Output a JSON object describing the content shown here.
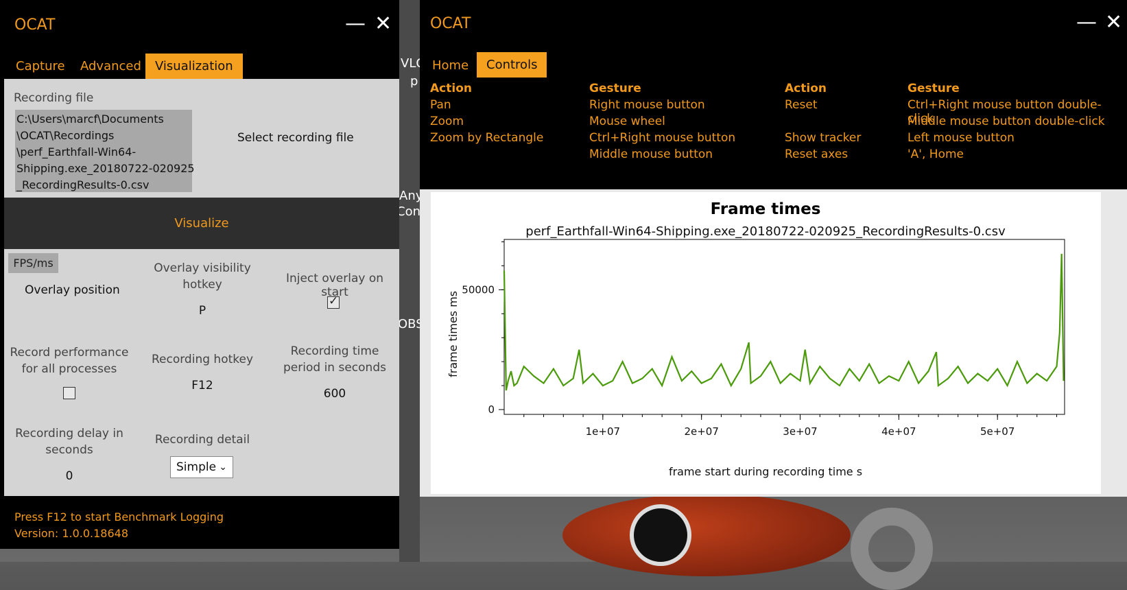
{
  "desktop": {
    "labels": [
      "VLC",
      "p",
      "Any",
      "Conv",
      "OBS"
    ]
  },
  "left_window": {
    "title": "OCAT",
    "tabs": [
      "Capture",
      "Advanced",
      "Visualization"
    ],
    "recording_file_label": "Recording file",
    "recording_file_lines": [
      "C:\\Users\\marcf\\Documents",
      "\\OCAT\\Recordings",
      "\\perf_Earthfall-Win64-",
      "Shipping.exe_20180722-020925",
      "_RecordingResults-0.csv"
    ],
    "select_file_button": "Select recording file",
    "visualize_button": "Visualize",
    "fps_badge": "FPS/ms",
    "overlay_position": "Overlay position",
    "overlay_hotkey_label_1": "Overlay visibility",
    "overlay_hotkey_label_2": "hotkey",
    "overlay_hotkey_value": "P",
    "inject_overlay_label": "Inject overlay on start",
    "record_all_label_1": "Record performance",
    "record_all_label_2": "for all processes",
    "recording_hotkey_label": "Recording hotkey",
    "recording_hotkey_value": "F12",
    "time_period_label_1": "Recording time",
    "time_period_label_2": "period in seconds",
    "time_period_value": "600",
    "delay_label_1": "Recording delay in",
    "delay_label_2": "seconds",
    "delay_value": "0",
    "detail_label": "Recording detail",
    "detail_value": "Simple",
    "footer_line1": "Press F12 to start Benchmark Logging",
    "footer_line2": "Version: 1.0.0.18648"
  },
  "right_window": {
    "title": "OCAT",
    "tabs": [
      "Home",
      "Controls"
    ],
    "controls": {
      "col1_header": "Action",
      "col2_header": "Gesture",
      "col3_header": "Action",
      "col4_header": "Gesture",
      "col1": [
        "Pan",
        "Zoom",
        "Zoom by Rectangle",
        ""
      ],
      "col2": [
        "Right mouse button",
        "Mouse wheel",
        "Ctrl+Right mouse button",
        "Middle mouse button"
      ],
      "col3": [
        "Reset",
        "",
        "Show tracker",
        "Reset axes"
      ],
      "col4": [
        "Ctrl+Right mouse button double-click",
        "Middle mouse button double-click",
        "Left mouse button",
        "'A', Home"
      ]
    }
  },
  "chart_data": {
    "type": "line",
    "title": "Frame times",
    "subtitle": "perf_Earthfall-Win64-Shipping.exe_20180722-020925_RecordingResults-0.csv",
    "xlabel": "frame start during recording time s",
    "ylabel": "frame times ms",
    "xlim": [
      0,
      56800000
    ],
    "ylim": [
      -2000,
      71000
    ],
    "xticks": [
      10000000,
      20000000,
      30000000,
      40000000,
      50000000
    ],
    "xtick_labels": [
      "1e+07",
      "2e+07",
      "3e+07",
      "4e+07",
      "5e+07"
    ],
    "yticks": [
      0,
      50000
    ],
    "ytick_labels": [
      "0",
      "50000"
    ],
    "color": "#4a9a0a",
    "series": [
      {
        "x": [
          0,
          200000,
          400000,
          700000,
          1000000,
          1300000,
          2000000,
          3000000,
          4000000,
          5000000,
          6000000,
          7000000,
          7600000,
          8000000,
          9000000,
          10000000,
          11000000,
          12000000,
          13000000,
          14000000,
          15000000,
          16000000,
          17000000,
          18000000,
          19000000,
          20000000,
          21000000,
          22000000,
          23000000,
          24000000,
          24800000,
          25000000,
          26000000,
          27000000,
          28000000,
          29000000,
          30000000,
          30500000,
          31000000,
          32000000,
          33000000,
          34000000,
          35000000,
          36000000,
          37000000,
          38000000,
          39000000,
          40000000,
          41000000,
          42000000,
          43000000,
          43800000,
          44000000,
          45000000,
          46000000,
          47000000,
          48000000,
          49000000,
          50000000,
          51000000,
          52000000,
          53000000,
          54000000,
          55000000,
          56000000,
          56300000,
          56500000,
          56700000
        ],
        "y": [
          58000,
          8000,
          12000,
          16000,
          10000,
          11000,
          18000,
          14000,
          11000,
          17000,
          10000,
          13000,
          25000,
          11000,
          15000,
          10000,
          12000,
          20000,
          11000,
          13000,
          17000,
          10000,
          22000,
          12000,
          16000,
          11000,
          13000,
          19000,
          10000,
          17000,
          28000,
          11000,
          14000,
          20000,
          11000,
          15000,
          12000,
          25000,
          11000,
          18000,
          13000,
          10000,
          17000,
          12000,
          19000,
          11000,
          14000,
          12000,
          20000,
          11000,
          16000,
          24000,
          10000,
          13000,
          18000,
          11000,
          15000,
          12000,
          17000,
          10000,
          20000,
          11000,
          15000,
          12000,
          18000,
          32000,
          65000,
          12000
        ]
      }
    ]
  }
}
